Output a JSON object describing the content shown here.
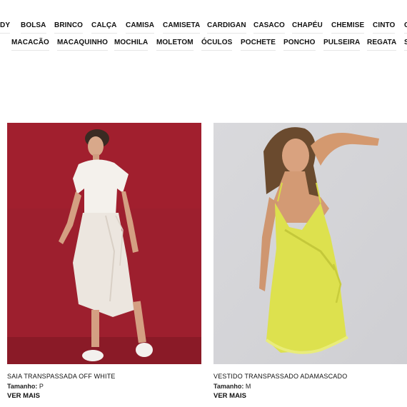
{
  "categories_row1": [
    "DY",
    "BOLSA",
    "BRINCO",
    "CALÇA",
    "CAMISA",
    "CAMISETA",
    "CARDIGAN",
    "CASACO",
    "CHAPÉU",
    "CHEMISE",
    "CINTO",
    "C"
  ],
  "categories_row2": [
    "MACACÃO",
    "MACAQUINHO",
    "MOCHILA",
    "MOLETOM",
    "ÓCULOS",
    "POCHETE",
    "PONCHO",
    "PULSEIRA",
    "REGATA",
    "S"
  ],
  "products": [
    {
      "title": "SAIA TRANSPASSADA OFF WHITE",
      "size_label": "Tamanho:",
      "size_value": "P",
      "cta": "VER MAIS",
      "bg_color": "#9d1f2e"
    },
    {
      "title": "VESTIDO TRANSPASSADO ADAMASCADO",
      "size_label": "Tamanho:",
      "size_value": "M",
      "cta": "VER MAIS",
      "bg_color": "#d6d6d9"
    }
  ]
}
